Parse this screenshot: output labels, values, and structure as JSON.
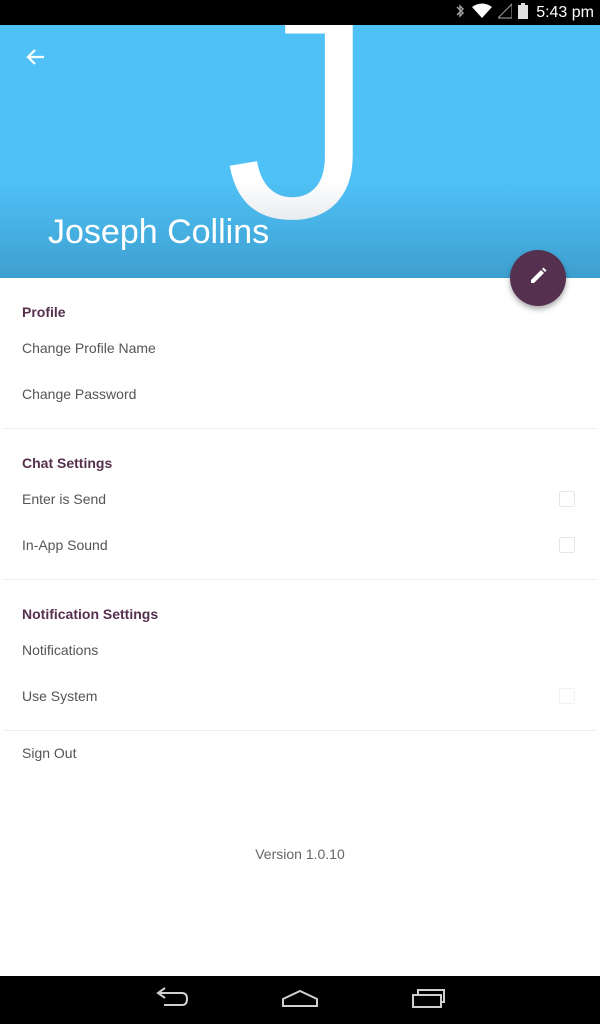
{
  "status_bar": {
    "time": "5:43 pm",
    "icons": [
      "bluetooth-icon",
      "wifi-icon",
      "signal-icon",
      "battery-icon"
    ]
  },
  "header": {
    "avatar_letter": "J",
    "name": "Joseph Collins",
    "background_color": "#4fc1f6",
    "back_icon": "arrow-left-icon"
  },
  "fab": {
    "icon": "pencil-icon",
    "color": "#55304f"
  },
  "sections": {
    "profile": {
      "title": "Profile",
      "items": [
        {
          "label": "Change Profile Name"
        },
        {
          "label": "Change Password"
        }
      ]
    },
    "chat": {
      "title": "Chat Settings",
      "items": [
        {
          "label": "Enter is Send",
          "checked": false
        },
        {
          "label": "In-App Sound",
          "checked": false
        }
      ]
    },
    "notification": {
      "title": "Notification Settings",
      "items": [
        {
          "label": "Notifications"
        },
        {
          "label": "Use System",
          "checked": false
        }
      ]
    },
    "sign_out": {
      "label": "Sign Out"
    }
  },
  "version": "Version 1.0.10",
  "nav_bar": {
    "icons": [
      "back-nav-icon",
      "home-nav-icon",
      "recents-nav-icon"
    ]
  },
  "accent_color": "#55304f"
}
